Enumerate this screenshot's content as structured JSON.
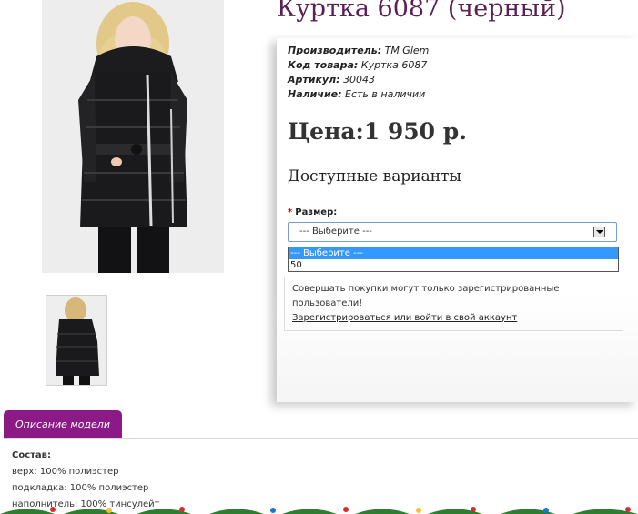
{
  "product": {
    "title": "Куртка 6087 (черный)",
    "images": {
      "main_alt": "product-main-photo",
      "thumb_alt": "product-thumbnail"
    }
  },
  "meta": {
    "manufacturer_label": "Производитель:",
    "manufacturer_value": "TM Glem",
    "code_label": "Код товара:",
    "code_value": "Куртка 6087",
    "sku_label": "Артикул:",
    "sku_value": "30043",
    "availability_label": "Наличие:",
    "availability_value": "Есть в наличии"
  },
  "price": "Цена:1 950 р.",
  "variants": {
    "heading": "Доступные варианты",
    "size_required_mark": "*",
    "size_label": "Размер:",
    "selected": "--- Выберите ---",
    "options": [
      "--- Выберите ---",
      "50"
    ]
  },
  "notice": {
    "text": "Совершать покупки могут только зарегистрированные пользователи!",
    "link": "Зарегистрироваться или войти в свой аккаунт"
  },
  "tabs": {
    "description": "Описание модели"
  },
  "description": {
    "heading": "Состав:",
    "lines": [
      "верх: 100% полиэстер",
      "подкладка: 100% полиэстер",
      "наполнитель: 100% тинсулейт"
    ]
  },
  "colors": {
    "title": "#5a1f55",
    "tab": "#8b1a86",
    "dropdown_selected": "#3399ff",
    "required": "#d40000"
  }
}
